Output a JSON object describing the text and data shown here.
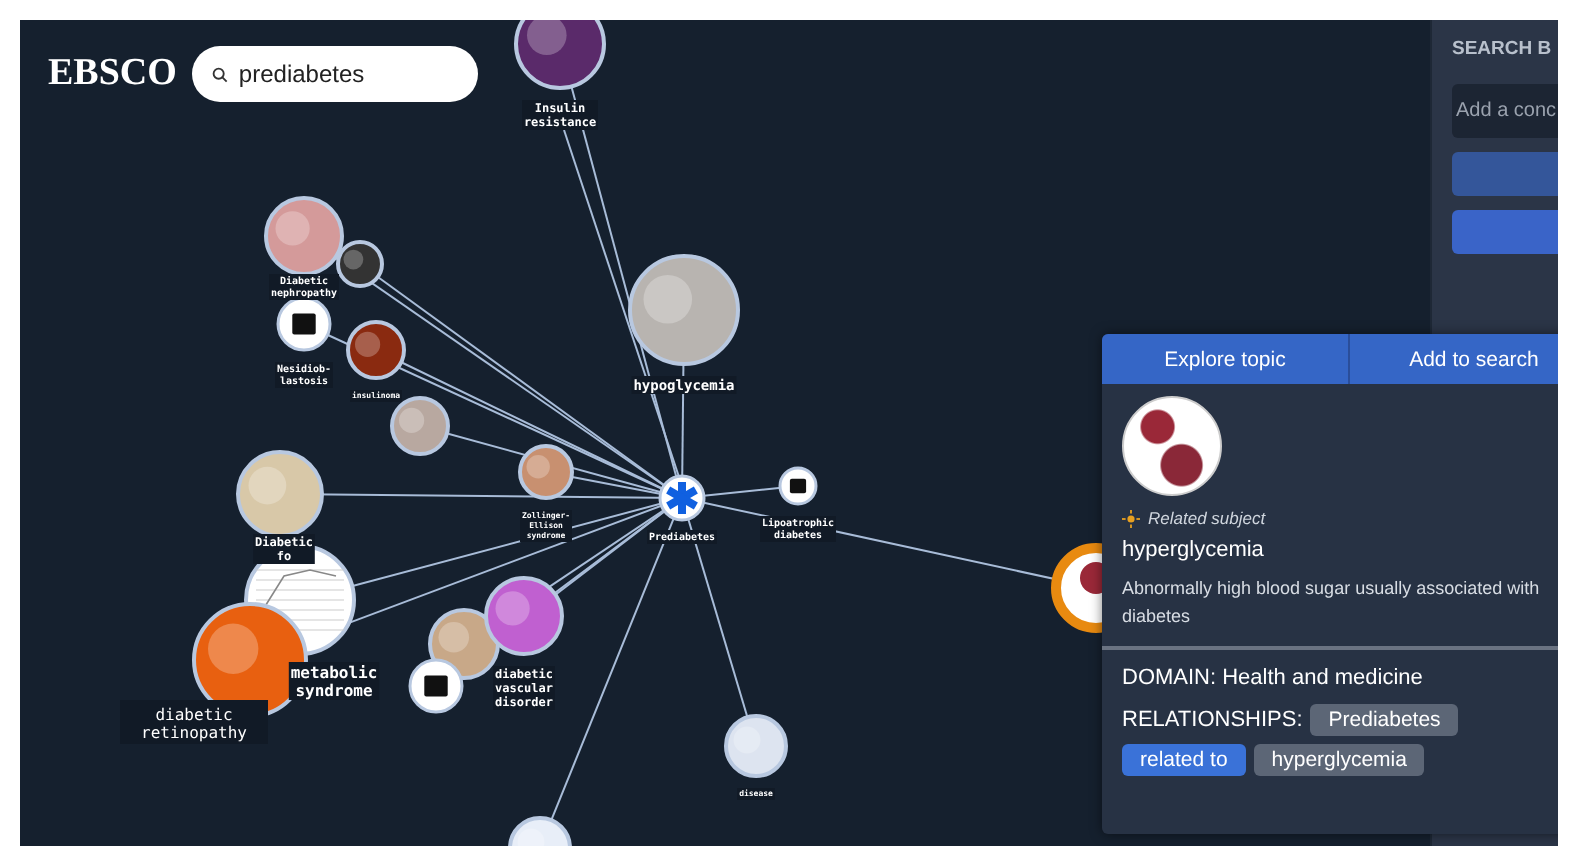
{
  "header": {
    "logo": "EBSCO",
    "search": {
      "value": "prediabetes"
    }
  },
  "sidebar": {
    "title": "SEARCH B",
    "input": {
      "placeholder": "Add a conc"
    }
  },
  "graph": {
    "nodes": [
      {
        "kind": "photo",
        "label_lines": [
          "Insulin",
          "resistance"
        ]
      },
      {
        "kind": "photo",
        "label_lines": [
          "Diabetic",
          "nephropathy"
        ]
      },
      {
        "kind": "icon",
        "label_lines": [
          "Nesidiob-",
          "lastosis"
        ]
      },
      {
        "kind": "photo"
      },
      {
        "kind": "photo",
        "label_lines": [
          "insulinoma"
        ]
      },
      {
        "kind": "photo",
        "label_lines": [
          "hypoglycemia"
        ]
      },
      {
        "kind": "photo"
      },
      {
        "kind": "photo",
        "label_lines": [
          "Zollinger-",
          "Ellison",
          "syndrome"
        ]
      },
      {
        "kind": "hub",
        "label_lines": [
          "Prediabetes"
        ]
      },
      {
        "kind": "icon",
        "label_lines": [
          "Lipoatrophic",
          "diabetes"
        ]
      },
      {
        "kind": "photo",
        "label_lines": [
          "Diabetic",
          "fo"
        ]
      },
      {
        "kind": "chart"
      },
      {
        "kind": "photo",
        "label_lines": [
          "metabolic",
          "syndrome"
        ]
      },
      {
        "kind": "photo"
      },
      {
        "kind": "photo",
        "label_lines": [
          "diabetic",
          "vascular",
          "disorder"
        ]
      },
      {
        "kind": "icon"
      },
      {
        "kind": "photo",
        "label_lines": [
          "disease"
        ]
      },
      {
        "kind": "focus"
      },
      {
        "kind": "photo"
      }
    ],
    "extra_label_lines": [
      "diabetic",
      "retinopathy"
    ]
  },
  "card": {
    "buttons": [
      "Explore topic",
      "Add to search"
    ],
    "type": "Related subject",
    "title": "hyperglycemia",
    "description": "Abnormally high blood sugar usually associated with diabetes",
    "domain": "DOMAIN: Health and medicine",
    "relationships_label": "RELATIONSHIPS:",
    "relationships": [
      {
        "text": "Prediabetes",
        "kind": "node"
      },
      {
        "text": "related to",
        "kind": "relation"
      },
      {
        "text": "hyperglycemia",
        "kind": "node"
      }
    ]
  }
}
